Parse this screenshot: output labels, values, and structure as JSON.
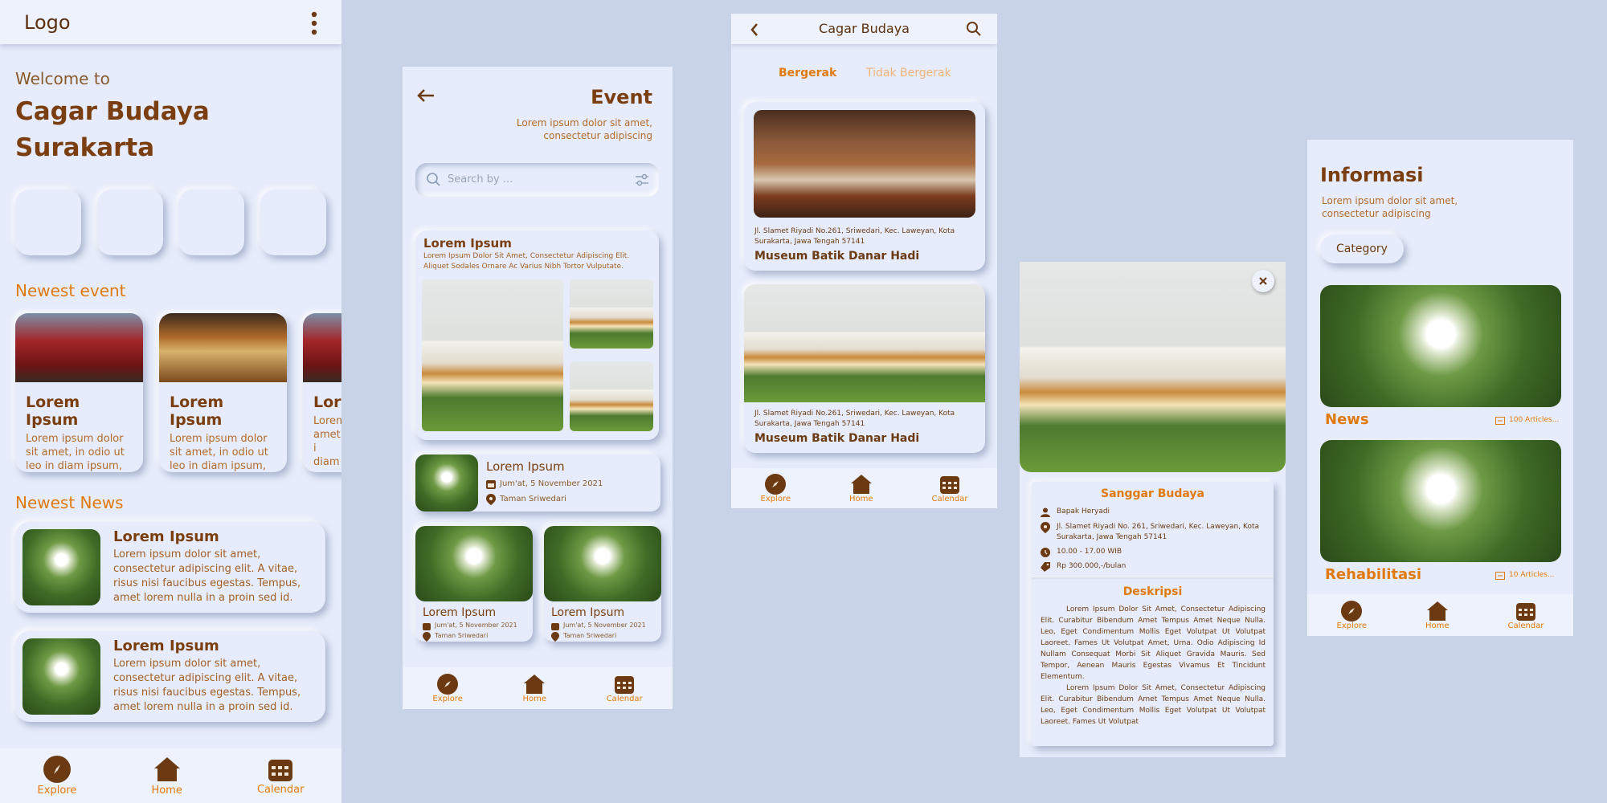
{
  "nav": {
    "explore": "Explore",
    "home": "Home",
    "calendar": "Calendar"
  },
  "home": {
    "logo": "Logo",
    "welcome": "Welcome to",
    "title_line1": "Cagar Budaya",
    "title_line2": "Surakarta",
    "newest_event_heading": "Newest event",
    "events": [
      {
        "title": "Lorem Ipsum",
        "desc": "Lorem ipsum dolor sit amet, in odio ut leo in diam ipsum, euismod."
      },
      {
        "title": "Lorem Ipsum",
        "desc": "Lorem ipsum dolor sit amet, in odio ut leo in diam ipsum, euismod."
      },
      {
        "title": "Lore",
        "desc": "Lorem amet, i diam"
      }
    ],
    "newest_news_heading": "Newest News",
    "news": [
      {
        "title": "Lorem Ipsum",
        "desc": "Lorem ipsum dolor sit amet, consectetur adipiscing elit. A vitae, risus nisi faucibus egestas. Tempus, amet lorem nulla in a proin sed id."
      },
      {
        "title": "Lorem Ipsum",
        "desc": "Lorem ipsum dolor sit amet, consectetur adipiscing elit. A vitae, risus nisi faucibus egestas. Tempus, amet lorem nulla in a proin sed id."
      }
    ]
  },
  "event": {
    "title": "Event",
    "subtitle_line1": "Lorem ipsum dolor sit amet,",
    "subtitle_line2": "consectetur adipiscing",
    "search_placeholder": "Search by ...",
    "featured": {
      "title": "Lorem Ipsum",
      "desc": "Lorem Ipsum Dolor Sit Amet, Consectetur Adipiscing Elit. Aliquet Sodales Ornare Ac Varius Nibh Tortor Vulputate."
    },
    "list_item": {
      "title": "Lorem Ipsum",
      "date": "Jum'at, 5 November 2021",
      "place": "Taman Sriwedari"
    },
    "cards": [
      {
        "title": "Lorem Ipsum",
        "date": "Jum'at, 5 November 2021",
        "place": "Taman Sriwedari"
      },
      {
        "title": "Lorem Ipsum",
        "date": "Jum'at, 5 November 2021",
        "place": "Taman Sriwedari"
      }
    ]
  },
  "cagar": {
    "title": "Cagar Budaya",
    "tab_active": "Bergerak",
    "tab_inactive": "Tidak Bergerak",
    "items": [
      {
        "address": "Jl. Slamet Riyadi No.261, Sriwedari, Kec. Laweyan, Kota Surakarta, Jawa Tengah 57141",
        "name": "Museum Batik Danar Hadi"
      },
      {
        "address": "Jl. Slamet Riyadi No.261, Sriwedari, Kec. Laweyan, Kota Surakarta, Jawa Tengah 57141",
        "name": "Museum Batik Danar Hadi"
      }
    ]
  },
  "detail": {
    "name": "Sanggar Budaya",
    "person": "Bapak Heryadi",
    "address": "Jl. Slamet Riyadi No. 261, Sriwedari, Kec. Laweyan, Kota Surakarta, Jawa Tengah 57141",
    "hours": "10.00 - 17.00 WIB",
    "price": "Rp 300.000,-/bulan",
    "desc_heading": "Deskripsi",
    "desc_p1": "Lorem Ipsum Dolor Sit Amet, Consectetur Adipiscing Elit. Curabitur Bibendum Amet Tempus Amet Neque Nulla. Leo, Eget Condimentum Mollis Eget Volutpat Ut Volutpat Laoreet. Fames Ut Volutpat Amet, Urna. Odio Adipiscing Id Nullam Consequat Morbi Sit Aliquet Gravida Mauris. Sed Tempor, Aenean Mauris Egestas Vivamus Et Tincidunt Elementum.",
    "desc_p2": "Lorem Ipsum Dolor Sit Amet, Consectetur Adipiscing Elit. Curabitur Bibendum Amet Tempus Amet Neque Nulla. Leo, Eget Condimentum Mollis Eget Volutpat Ut Volutpat Laoreet. Fames Ut Volutpat"
  },
  "info": {
    "title": "Informasi",
    "subtitle_line1": "Lorem ipsum dolor sit amet,",
    "subtitle_line2": "consectetur adipiscing",
    "category": "Category",
    "sections": [
      {
        "name": "News",
        "count": "100 Articles..."
      },
      {
        "name": "Rehabilitasi",
        "count": "10 Articles..."
      }
    ]
  }
}
